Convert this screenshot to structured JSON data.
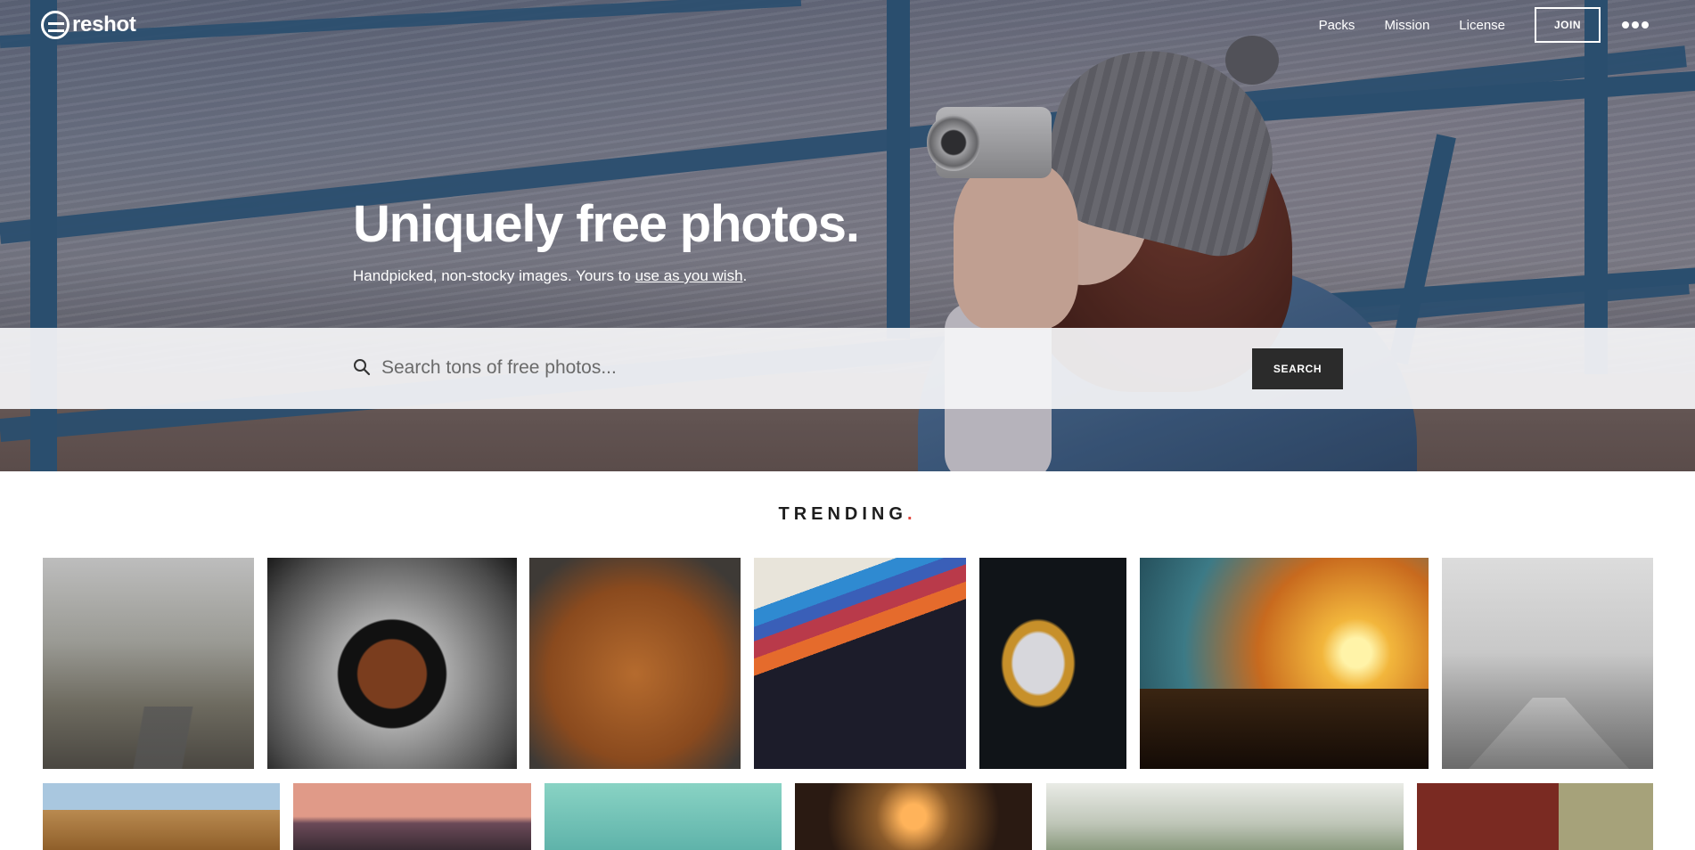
{
  "brand": {
    "name": "reshot"
  },
  "nav": {
    "links": [
      {
        "label": "Packs"
      },
      {
        "label": "Mission"
      },
      {
        "label": "License"
      }
    ],
    "join_label": "JOIN",
    "more_icon": "ellipsis-icon"
  },
  "hero": {
    "headline": "Uniquely free photos.",
    "subline_prefix": "Handpicked, non-stocky images. Yours to ",
    "subline_link": "use as you wish",
    "subline_suffix": "."
  },
  "search": {
    "placeholder": "Search tons of free photos...",
    "value": "",
    "button_label": "SEARCH"
  },
  "trending": {
    "title": "TRENDING",
    "dot": ".",
    "accent_color": "#e2453c"
  },
  "colors": {
    "accent": "#e2453c",
    "button_dark": "#2b2b2b"
  }
}
